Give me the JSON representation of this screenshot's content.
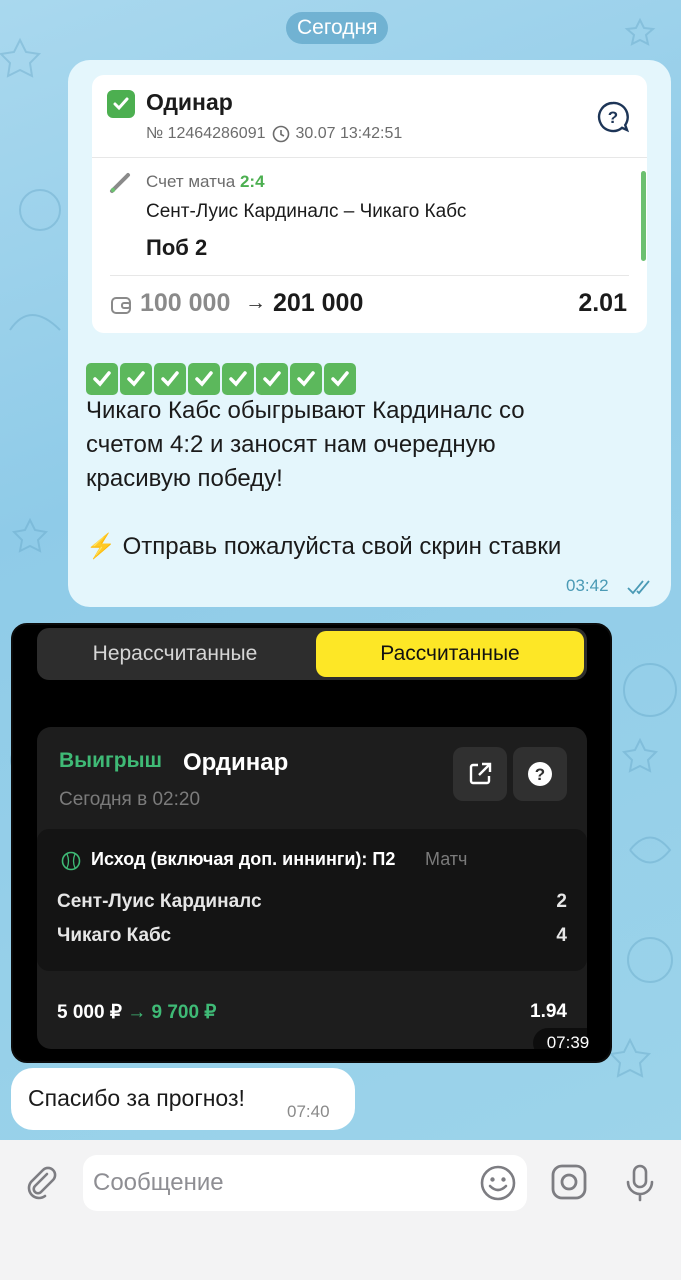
{
  "date_label": "Сегодня",
  "bet_card": {
    "title": "Одинар",
    "number": "№ 12464286091",
    "datetime": "30.07 13:42:51",
    "score_label": "Счет матча",
    "score": "2:4",
    "teams": "Сент-Луис Кардиналс – Чикаго Кабс",
    "pick": "Поб 2",
    "stake": "100 000",
    "arrow": "→",
    "payout": "201 000",
    "coef": "2.01"
  },
  "message1": {
    "checkmarks": "✅✅✅✅✅✅✅✅",
    "line1": "Чикаго Кабс обыгрывают Кардиналс со",
    "line2": "счетом 4:2 и заносят нам очередную",
    "line3": "красивую победу!",
    "bolt": "⚡",
    "line4": "Отправь пожалуйста свой скрин ставки",
    "time": "03:42"
  },
  "screenshot": {
    "tab_left": "Нерассчитанные",
    "tab_right": "Рассчитанные",
    "result": "Выигрыш",
    "type": "Ординар",
    "date": "Сегодня в 02:20",
    "outcome": "Исход (включая доп. иннинги): П2",
    "match_label": "Матч",
    "team1": "Сент-Луис Кардиналс",
    "team1_score": "2",
    "team2": "Чикаго Кабс",
    "team2_score": "4",
    "stake": "5 000 ₽",
    "arrow": "→",
    "payout": "9 700 ₽",
    "coef": "1.94",
    "time": "07:39"
  },
  "message2": {
    "text": "Спасибо за прогноз!",
    "time": "07:40"
  },
  "composer": {
    "placeholder": "Сообщение"
  },
  "colors": {
    "accent_green": "#4caf50",
    "win_green": "#3fba76",
    "tab_yellow": "#fde726",
    "time_blue": "#4a9ab5"
  },
  "icons": [
    "attach-icon",
    "emoji-icon",
    "camera-icon",
    "microphone-icon",
    "help-icon",
    "share-icon",
    "baseball-icon",
    "wallet-icon",
    "clock-icon",
    "read-ticks-icon"
  ]
}
